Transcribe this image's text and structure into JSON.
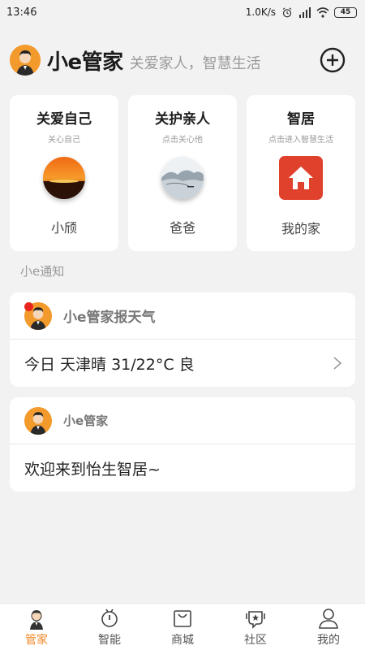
{
  "status": {
    "time": "13:46",
    "speed": "1.0K/s",
    "battery": "45"
  },
  "header": {
    "title": "小e管家",
    "slogan": "关爱家人，智慧生活"
  },
  "cards": [
    {
      "title": "关爱自己",
      "subtitle": "关心自己",
      "name": "小颀"
    },
    {
      "title": "关护亲人",
      "subtitle": "点击关心他",
      "name": "爸爸"
    },
    {
      "title": "智居",
      "subtitle": "点击进入智慧生活",
      "name": "我的家"
    }
  ],
  "section_label": "小e通知",
  "notices": [
    {
      "title": "小e管家报天气",
      "body": "今日 天津晴 31/22°C 良"
    },
    {
      "title": "小e管家",
      "body": "欢迎来到怡生智居~"
    }
  ],
  "tabs": [
    {
      "label": "管家",
      "icon": "butler-icon"
    },
    {
      "label": "智能",
      "icon": "device-icon"
    },
    {
      "label": "商城",
      "icon": "shopping-bag-icon"
    },
    {
      "label": "社区",
      "icon": "community-icon"
    },
    {
      "label": "我的",
      "icon": "person-icon"
    }
  ],
  "colors": {
    "accent": "#f5841f",
    "home_tile": "#e0412d",
    "notice_dot": "#e7261f"
  }
}
